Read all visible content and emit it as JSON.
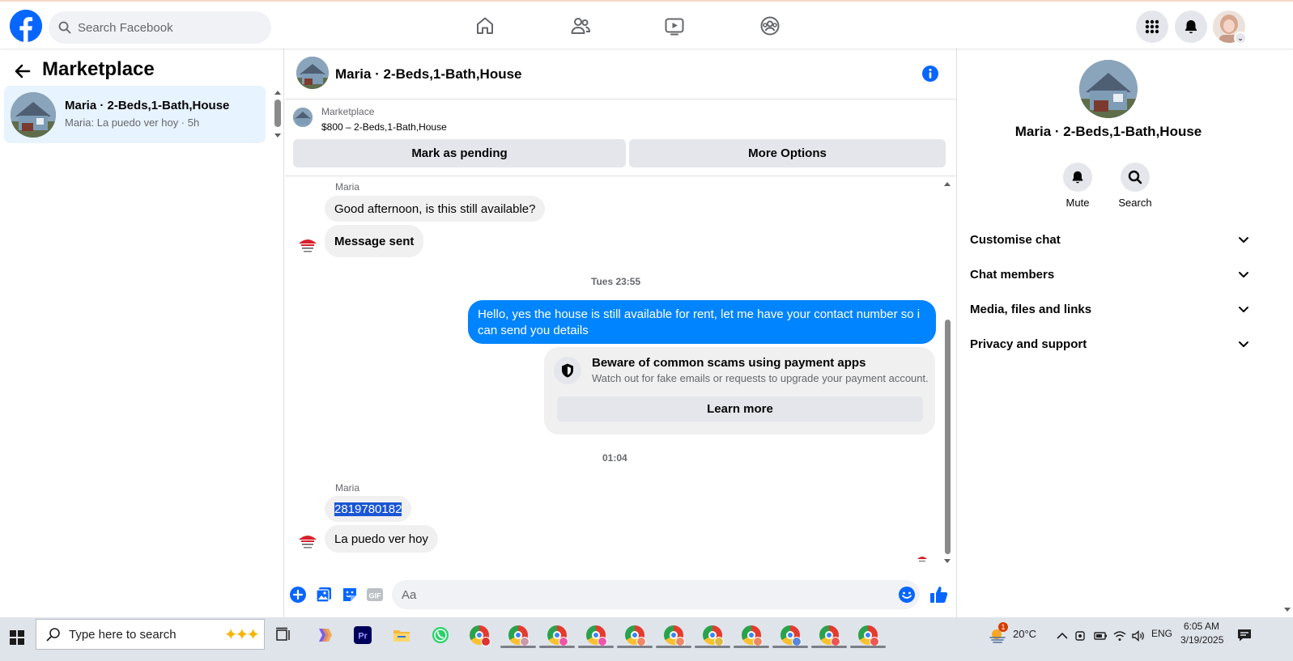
{
  "topbar": {
    "search_placeholder": "Search Facebook",
    "nav_icons": [
      "home-icon",
      "friends-icon",
      "watch-icon",
      "groups-icon"
    ],
    "right_icons": [
      "menu-grid-icon",
      "notifications-bell-icon"
    ],
    "brand_color": "#0866ff"
  },
  "left_panel": {
    "title": "Marketplace",
    "conversations": [
      {
        "name": "Maria · 2-Beds,1-Bath,House",
        "preview": "Maria: La puedo ver hoy · 5h"
      }
    ]
  },
  "chat": {
    "title": "Maria · 2-Beds,1-Bath,House",
    "listing": {
      "source": "Marketplace",
      "price_line": "$800 – 2-Beds,1-Bath,House",
      "mark_pending_label": "Mark as pending",
      "more_options_label": "More Options"
    },
    "messages": {
      "sender_1": "Maria",
      "in_1": "Good afternoon, is this still available?",
      "in_2": "Message sent",
      "time_1": "Tues 23:55",
      "out_1": "Hello, yes the house is still available for rent, let me have your contact number so i can send you details",
      "scam_title": "Beware of common scams using payment apps",
      "scam_desc": "Watch out for fake emails or requests to upgrade your payment account.",
      "learn_more_label": "Learn more",
      "time_2": "01:04",
      "sender_2": "Maria",
      "in_3": "2819780182",
      "in_4": "La puedo ver hoy"
    },
    "composer_placeholder": "Aa",
    "outgoing_color": "#0084ff"
  },
  "right_panel": {
    "name": "Maria · 2-Beds,1-Bath,House",
    "mute_label": "Mute",
    "search_label": "Search",
    "sections": [
      "Customise chat",
      "Chat members",
      "Media, files and links",
      "Privacy and support"
    ]
  },
  "taskbar": {
    "search_text": "Type here to search",
    "weather_badge": "1",
    "temperature": "20°C",
    "language": "ENG",
    "time": "6:05 AM",
    "date": "3/19/2025"
  }
}
